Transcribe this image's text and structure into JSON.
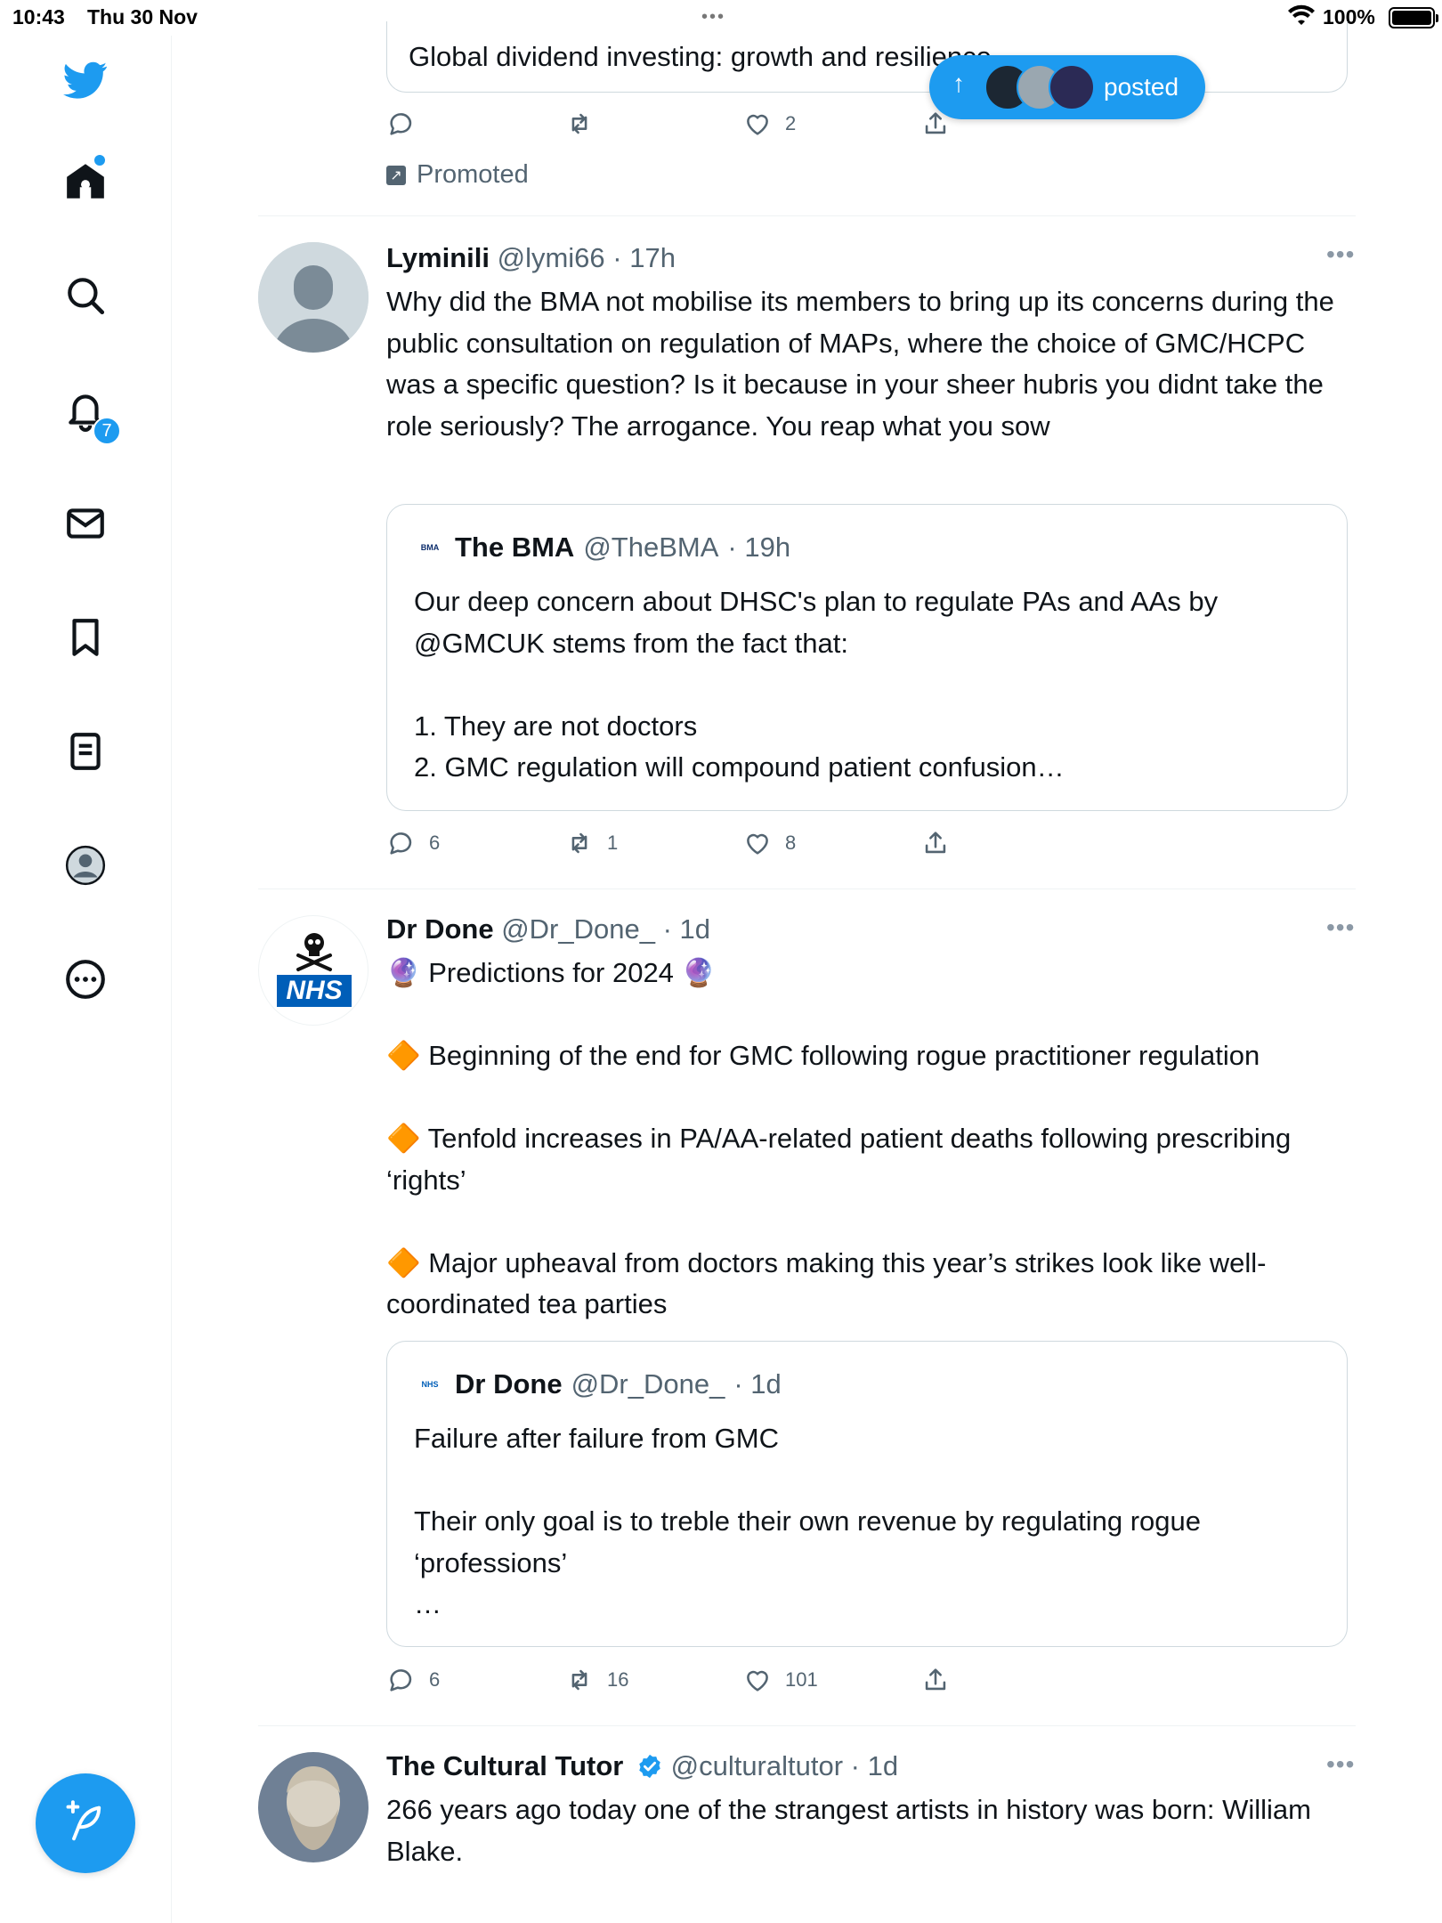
{
  "status_bar": {
    "time": "10:43",
    "date": "Thu 30 Nov",
    "dots": "•••",
    "battery": "100%"
  },
  "sidebar": {
    "items": [
      {
        "name": "home",
        "icon": "home-icon"
      },
      {
        "name": "explore",
        "icon": "search-icon"
      },
      {
        "name": "notifications",
        "icon": "bell-icon",
        "badge": "7"
      },
      {
        "name": "messages",
        "icon": "mail-icon"
      },
      {
        "name": "bookmarks",
        "icon": "bookmark-icon"
      },
      {
        "name": "lists",
        "icon": "list-icon"
      },
      {
        "name": "profile",
        "icon": "profile-icon"
      },
      {
        "name": "more",
        "icon": "more-circle-icon"
      }
    ],
    "compose_icon": "compose-feather-icon"
  },
  "colors": {
    "accent": "#1d9bf0",
    "text": "#0f1419",
    "muted": "#536471",
    "border": "#cfd9de"
  },
  "banner": {
    "label": "posted"
  },
  "promoted_tweet": {
    "card_text": "Global dividend investing: growth and resilience",
    "likes": "2",
    "promoted_label": "Promoted"
  },
  "tweets": [
    {
      "name": "Lyminili",
      "handle": "@lymi66",
      "time": "· 17h",
      "text": "Why did the BMA not mobilise its members to bring up its concerns during the public consultation on regulation of MAPs, where the choice of GMC/HCPC was a specific question? Is it because in your sheer hubris you didnt take the role seriously? The arrogance. You reap what you sow",
      "quote": {
        "logo": "BMA",
        "name": "The BMA",
        "handle": "@TheBMA",
        "time": "· 19h",
        "text": "Our deep concern about DHSC's plan to regulate PAs and AAs by @GMCUK stems from the fact that:\n\n1. They are not doctors\n2. GMC regulation will compound patient confusion…"
      },
      "replies": "6",
      "retweets": "1",
      "likes": "8"
    },
    {
      "name": "Dr Done",
      "handle": "@Dr_Done_",
      "time": "· 1d",
      "avatar_text": "NHS",
      "text": "🔮 Predictions for 2024 🔮\n\n🔶 Beginning of the end for GMC following rogue practitioner regulation\n\n🔶 Tenfold increases in PA/AA-related patient deaths following prescribing ‘rights’\n\n🔶 Major upheaval from doctors making this year’s strikes look like well-coordinated tea parties",
      "quote": {
        "logo": "NHS",
        "name": "Dr Done",
        "handle": "@Dr_Done_",
        "time": "· 1d",
        "text": "Failure after failure from GMC\n\nTheir only goal is to treble their own revenue by regulating rogue ‘professions’\n…"
      },
      "replies": "6",
      "retweets": "16",
      "likes": "101"
    },
    {
      "name": "The Cultural Tutor",
      "handle": "@culturaltutor",
      "time": "· 1d",
      "verified": true,
      "text": "266 years ago today one of the strangest artists in history was born: William Blake."
    }
  ]
}
